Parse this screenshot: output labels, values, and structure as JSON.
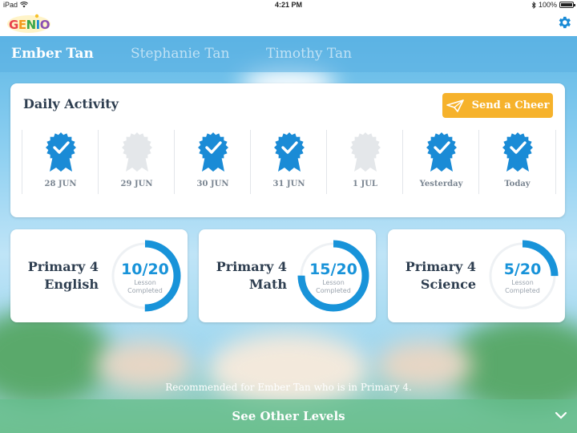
{
  "status_bar": {
    "device": "iPad",
    "time": "4:21 PM",
    "battery": "100%",
    "battery_level": 1.0
  },
  "header": {
    "logo_text": "GENIO",
    "settings_icon": "gear-icon"
  },
  "student_tabs": [
    {
      "label": "Ember Tan",
      "active": true
    },
    {
      "label": "Stephanie Tan",
      "active": false
    },
    {
      "label": "Timothy Tan",
      "active": false
    }
  ],
  "daily_activity": {
    "title": "Daily Activity",
    "cheer_button": "Send a Cheer",
    "days": [
      {
        "label": "28 JUN",
        "completed": true
      },
      {
        "label": "29 JUN",
        "completed": false
      },
      {
        "label": "30 JUN",
        "completed": true
      },
      {
        "label": "31 JUN",
        "completed": true
      },
      {
        "label": "1 JUL",
        "completed": false
      },
      {
        "label": "Yesterday",
        "completed": true
      },
      {
        "label": "Today",
        "completed": true
      }
    ]
  },
  "subjects": [
    {
      "line1": "Primary 4",
      "line2": "English",
      "completed": 10,
      "total": 20,
      "count_text": "10/20",
      "sub_line1": "Lesson",
      "sub_line2": "Completed"
    },
    {
      "line1": "Primary 4",
      "line2": "Math",
      "completed": 15,
      "total": 20,
      "count_text": "15/20",
      "sub_line1": "Lesson",
      "sub_line2": "Completed"
    },
    {
      "line1": "Primary 4",
      "line2": "Science",
      "completed": 5,
      "total": 20,
      "count_text": "5/20",
      "sub_line1": "Lesson",
      "sub_line2": "Completed"
    }
  ],
  "recommendation": "Recommended for Ember Tan who is in Primary 4.",
  "levels_bar": {
    "label": "See Other Levels"
  },
  "colors": {
    "accent": "#1893d9",
    "cheer": "#f6b22b",
    "title_text": "#2e3e50",
    "badge_done": "#1a8bd6",
    "badge_pending": "#e4e7ea"
  }
}
